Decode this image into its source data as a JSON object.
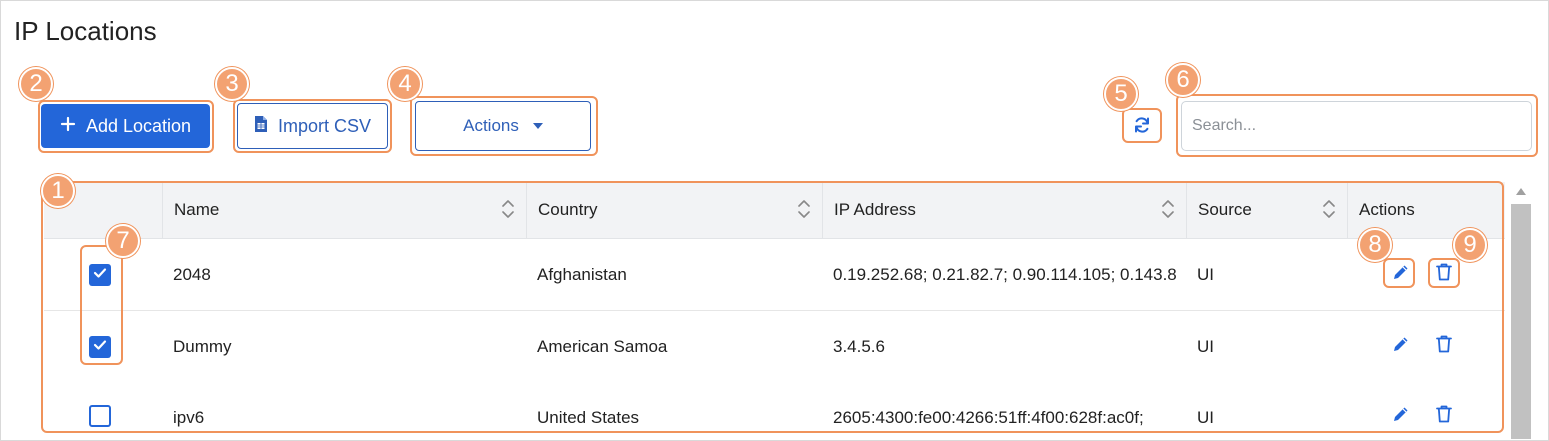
{
  "page": {
    "title": "IP Locations"
  },
  "toolbar": {
    "add_label": "Add Location",
    "import_label": "Import CSV",
    "actions_label": "Actions",
    "search_placeholder": "Search..."
  },
  "colors": {
    "primary": "#2366d9",
    "outline": "#2e5fb8",
    "annotation": "#f0935b"
  },
  "table": {
    "columns": [
      "Name",
      "Country",
      "IP Address",
      "Source",
      "Actions"
    ],
    "rows": [
      {
        "checked": true,
        "name": "2048",
        "country": "Afghanistan",
        "ip": "0.19.252.68; 0.21.82.7; 0.90.114.105; 0.143.8",
        "source": "UI"
      },
      {
        "checked": true,
        "name": "Dummy",
        "country": "American Samoa",
        "ip": "3.4.5.6",
        "source": "UI"
      },
      {
        "checked": false,
        "name": "ipv6",
        "country": "United States",
        "ip": "2605:4300:fe00:4266:51ff:4f00:628f:ac0f;",
        "source": "UI"
      }
    ]
  },
  "annotations": [
    "1",
    "2",
    "3",
    "4",
    "5",
    "6",
    "7",
    "8",
    "9"
  ],
  "icons": {
    "plus": "plus-icon",
    "csv": "file-csv-icon",
    "caret": "caret-down-icon",
    "refresh": "refresh-icon",
    "sort": "sort-icon",
    "check": "check-icon",
    "edit": "pencil-icon",
    "delete": "trash-icon"
  }
}
